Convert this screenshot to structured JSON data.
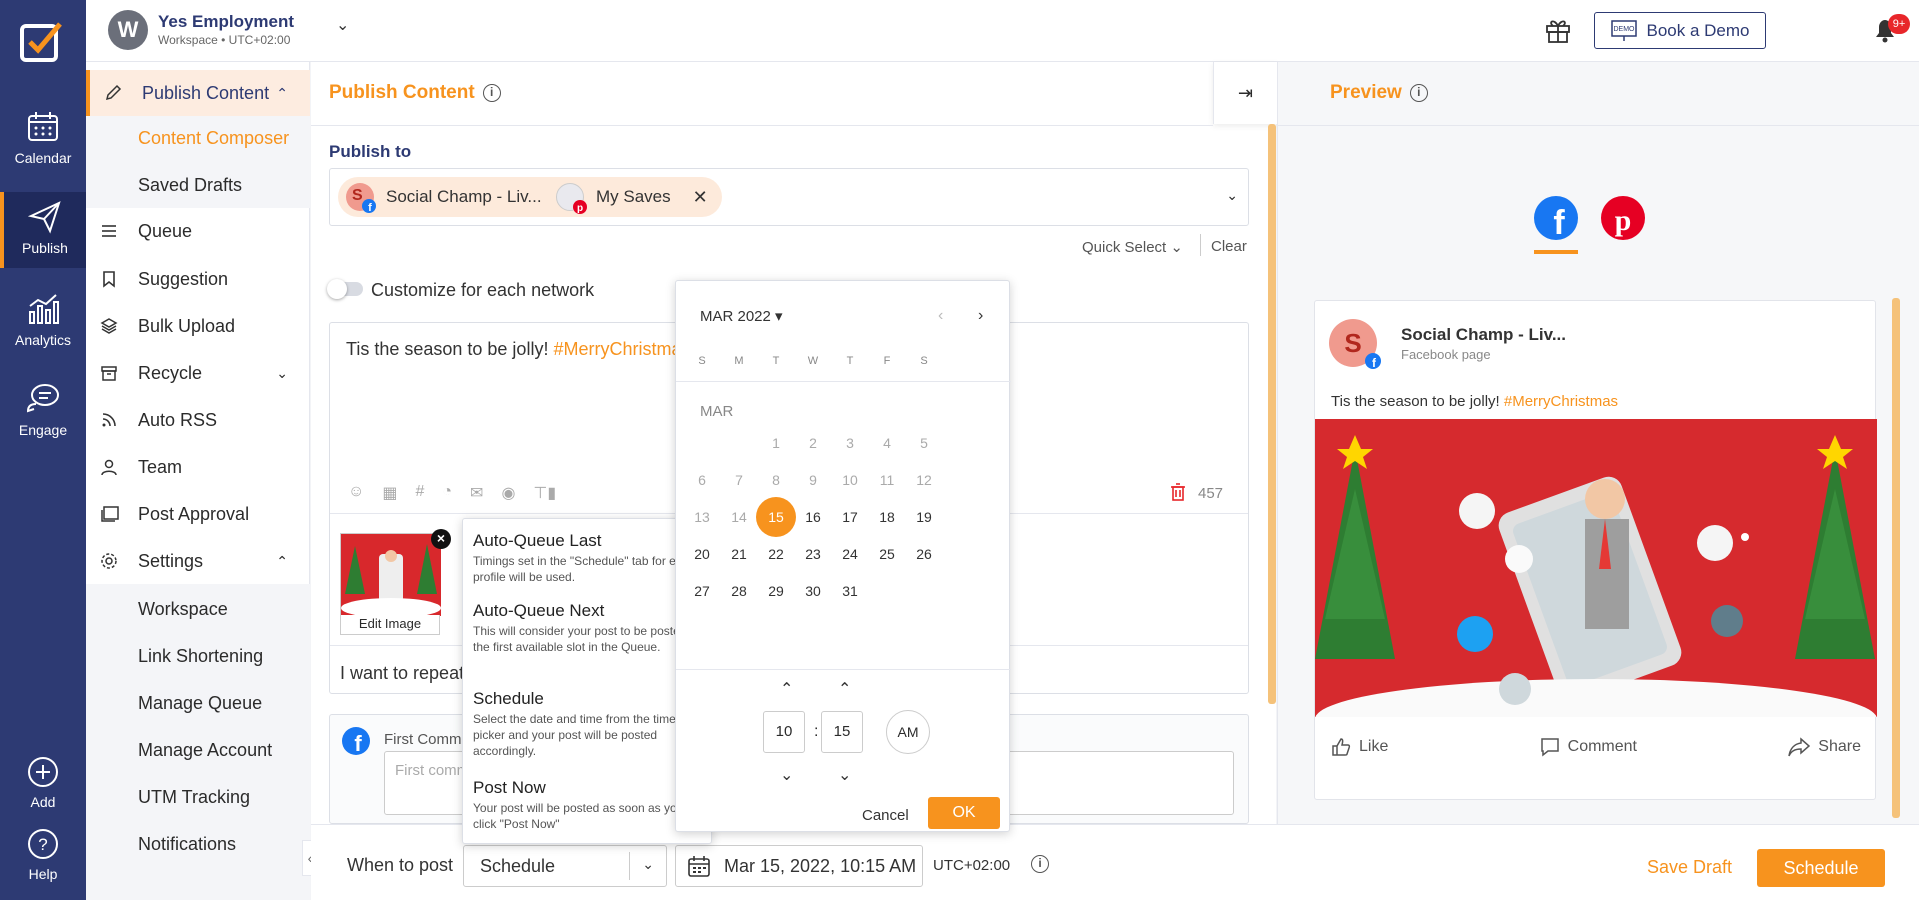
{
  "rail": {
    "items": [
      {
        "label": "Calendar",
        "icon": "calendar-icon"
      },
      {
        "label": "Publish",
        "icon": "paper-plane-icon"
      },
      {
        "label": "Analytics",
        "icon": "analytics-icon"
      },
      {
        "label": "Engage",
        "icon": "chat-icon"
      },
      {
        "label": "Add",
        "icon": "plus-circle-icon"
      },
      {
        "label": "Help",
        "icon": "help-icon"
      }
    ]
  },
  "topbar": {
    "workspace_initial": "W",
    "workspace_name": "Yes Employment",
    "workspace_sub": "Workspace • UTC+02:00",
    "book_demo": "Book a Demo",
    "demo_icon_text": "DEMO",
    "notif_badge": "9+"
  },
  "submenu": {
    "publish_content": "Publish Content",
    "content_composer": "Content Composer",
    "saved_drafts": "Saved Drafts",
    "queue": "Queue",
    "suggestion": "Suggestion",
    "bulk_upload": "Bulk Upload",
    "recycle": "Recycle",
    "auto_rss": "Auto RSS",
    "team": "Team",
    "post_approval": "Post Approval",
    "settings": "Settings",
    "workspace": "Workspace",
    "link_shortening": "Link Shortening",
    "manage_queue": "Manage Queue",
    "manage_account": "Manage Account",
    "utm_tracking": "UTM Tracking",
    "notifications": "Notifications"
  },
  "main": {
    "title": "Publish Content",
    "publish_to": "Publish to",
    "chips": [
      {
        "initial": "S",
        "label": "Social Champ - Liv..."
      },
      {
        "label": "My Saves"
      }
    ],
    "quick_select": "Quick Select",
    "clear": "Clear",
    "customize": "Customize for each network",
    "post_text": "Tis the season to be jolly! ",
    "post_hash": "#MerryChristmas",
    "char_count": "457",
    "edit_image": "Edit Image",
    "repeat_text": "I want to repeat",
    "first_comment": "First Comment",
    "first_comment_placeholder": "First comment"
  },
  "schedule_options": [
    {
      "title": "Auto-Queue Last",
      "desc": "Timings set in the \"Schedule\" tab for each profile will be used."
    },
    {
      "title": "Auto-Queue Next",
      "desc": "This will consider your post to be posted in the first available slot in the Queue."
    },
    {
      "title": "Schedule",
      "desc": "Select the date and time from the time picker and your post will be posted accordingly."
    },
    {
      "title": "Post Now",
      "desc": "Your post will be posted as soon as you click \"Post Now\""
    }
  ],
  "datepicker": {
    "month_label": "MAR 2022",
    "weekdays": [
      "S",
      "M",
      "T",
      "W",
      "T",
      "F",
      "S"
    ],
    "section_label": "MAR",
    "selected_day": 15,
    "days_in_month": 31,
    "first_weekday": 2,
    "hour": "10",
    "minute": "15",
    "ampm": "AM",
    "cancel": "Cancel",
    "ok": "OK"
  },
  "preview": {
    "title": "Preview",
    "card_initial": "S",
    "card_name": "Social Champ - Liv...",
    "card_sub": "Facebook page",
    "card_text": "Tis the season to be jolly! ",
    "card_hash": "#MerryChristmas",
    "like": "Like",
    "comment": "Comment",
    "share": "Share"
  },
  "bottombar": {
    "when_label": "When to post",
    "when_value": "Schedule",
    "datetime": "Mar 15, 2022, 10:15 AM",
    "timezone": "UTC+02:00",
    "save_draft": "Save Draft",
    "schedule": "Schedule"
  },
  "colors": {
    "accent": "#f7931e",
    "navy": "#2d3a73",
    "facebook": "#1877f2",
    "pinterest": "#e60023"
  }
}
